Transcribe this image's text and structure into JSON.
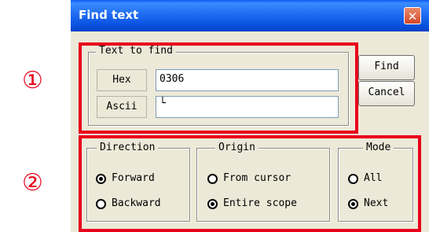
{
  "markers": {
    "one": "①",
    "two": "②"
  },
  "window": {
    "title": "Find text",
    "close_glyph": "✕"
  },
  "text_group": {
    "legend": "Text to find",
    "hex_label": "Hex",
    "hex_value": "0306",
    "ascii_label": "Ascii",
    "ascii_value": "└"
  },
  "buttons": {
    "find": "Find",
    "cancel": "Cancel"
  },
  "direction": {
    "legend": "Direction",
    "options": [
      {
        "label": "Forward",
        "selected": true
      },
      {
        "label": "Backward",
        "selected": false
      }
    ]
  },
  "origin": {
    "legend": "Origin",
    "options": [
      {
        "label": "From cursor",
        "selected": false
      },
      {
        "label": "Entire scope",
        "selected": true
      }
    ]
  },
  "mode": {
    "legend": "Mode",
    "options": [
      {
        "label": "All",
        "selected": false
      },
      {
        "label": "Next",
        "selected": true
      }
    ]
  },
  "colors": {
    "highlight": "#e8001a",
    "titlebar": "#0a52e0",
    "dialog_bg": "#ece9d8"
  }
}
